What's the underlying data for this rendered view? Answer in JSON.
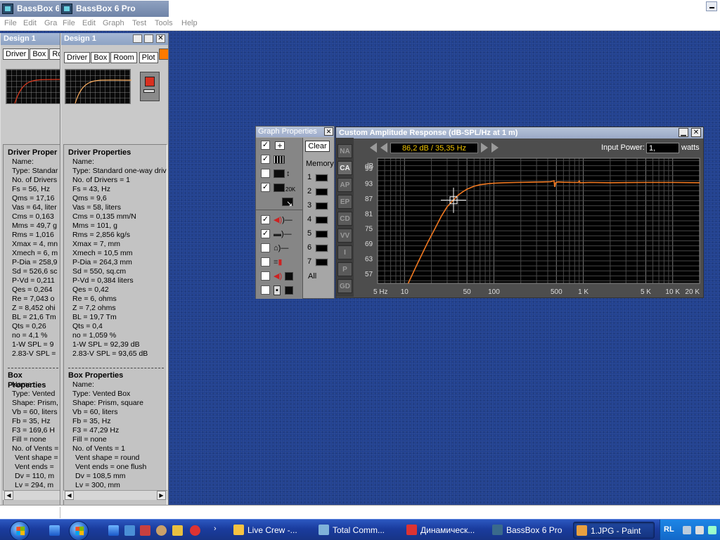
{
  "app_titles": [
    "BassBox 6",
    "BassBox 6 Pro"
  ],
  "menus": [
    [
      "File",
      "Edit",
      "Gra"
    ],
    [
      "File",
      "Edit",
      "Graph",
      "Test",
      "Tools",
      "Help"
    ]
  ],
  "design1": {
    "title": "Design 1",
    "tabs": [
      "Driver",
      "Box",
      "Ro"
    ],
    "driver_heading": "Driver Proper",
    "driver_lines": [
      "Name:",
      "Type: Standar",
      "No. of Drivers",
      "Fs = 56, Hz",
      "Qms = 17,16",
      "Vas = 64, liter",
      "Cms = 0,163",
      "Mms = 49,7 g",
      "Rms = 1,016",
      "Xmax = 4, mn",
      "Xmech = 6, m",
      "P-Dia = 258,9",
      "Sd = 526,6 sc",
      "P-Vd = 0,211",
      "Qes = 0,264",
      "Re = 7,043 o",
      "Z = 8,452 ohi",
      "BL = 21,6 Tm",
      "Qts = 0,26",
      "no = 4,1 %",
      "1-W SPL = 9",
      "2.83-V SPL ="
    ],
    "box_heading": "Box Properties",
    "box_lines": [
      "Name:",
      "Type: Vented",
      "Shape: Prism,",
      "Vb = 60, liters",
      "Fb = 35, Hz",
      "F3 = 169,6 H",
      "Fill = none",
      "No. of Vents ="
    ],
    "vent_lines": [
      "Vent shape =",
      "Vent ends ="
    ],
    "dim_lines": [
      "Dv = 110, m",
      "Lv = 294, m"
    ]
  },
  "design2": {
    "title": "Design 1",
    "tabs": [
      "Driver",
      "Box",
      "Room",
      "Plot"
    ],
    "driver_heading": "Driver Properties",
    "driver_lines": [
      "Name:",
      "Type: Standard one-way driv",
      "No. of Drivers = 1",
      "Fs = 43, Hz",
      "Qms = 9,6",
      "Vas = 58, liters",
      "Cms = 0,135 mm/N",
      "Mms = 101, g",
      "Rms = 2,856 kg/s",
      "Xmax = 7, mm",
      "Xmech = 10,5 mm",
      "P-Dia = 264,3 mm",
      "Sd = 550, sq.cm",
      "P-Vd = 0,384 liters",
      "Qes = 0,42",
      "Re = 6, ohms",
      "Z = 7,2 ohms",
      "BL = 19,7 Tm",
      "Qts = 0,4",
      "no = 1,059 %",
      "1-W SPL = 92,39 dB",
      "2.83-V SPL = 93,65 dB"
    ],
    "box_heading": "Box Properties",
    "box_lines": [
      "Name:",
      "Type: Vented Box",
      "Shape: Prism, square",
      "Vb = 60, liters",
      "Fb = 35, Hz",
      "F3 = 47,29 Hz",
      "Fill = none",
      "No. of Vents = 1"
    ],
    "vent_lines": [
      "Vent shape = round",
      "Vent ends = one flush"
    ],
    "dim_lines": [
      "Dv = 108,5 mm",
      "Lv = 300, mm"
    ]
  },
  "graph_props": {
    "title": "Graph Properties",
    "clear_label": "Clear",
    "memory_label": "Memory",
    "memory_slots": [
      "1",
      "2",
      "3",
      "4",
      "5",
      "6",
      "7"
    ],
    "all_label": "All",
    "option_icons": [
      "crosshair-icon",
      "grid-icon",
      "scale-vertical-icon",
      "extend-20k-icon",
      "graph-export-icon",
      "speaker-icon",
      "driver-icon",
      "room-icon",
      "amplifier-icon",
      "speaker-eq-icon",
      "box-eq-icon"
    ],
    "option_checked": [
      true,
      true,
      false,
      true,
      false,
      true,
      true,
      false,
      false,
      false,
      false
    ],
    "range_label": "20K"
  },
  "response": {
    "title": "Custom Amplitude Response (dB-SPL/Hz at 1 m)",
    "tabs": [
      "NA",
      "CA",
      "AP",
      "EP",
      "CD",
      "VV",
      "I",
      "P",
      "GD"
    ],
    "active_tab": "CA",
    "readout": "86,2 dB / 35,35 Hz",
    "input_power_label": "Input Power:",
    "input_power_value": "1,",
    "input_power_unit": "watts",
    "db_label": "dB",
    "curve_color": "#f07820"
  },
  "chart_data": {
    "type": "line",
    "xlabel": "",
    "ylabel": "dB",
    "x_scale": "log",
    "xlim": [
      5,
      20000
    ],
    "ylim": [
      53,
      103
    ],
    "x_ticks": [
      {
        "v": 5,
        "label": "5 Hz"
      },
      {
        "v": 10,
        "label": "10"
      },
      {
        "v": 50,
        "label": "50"
      },
      {
        "v": 100,
        "label": "100"
      },
      {
        "v": 500,
        "label": "500"
      },
      {
        "v": 1000,
        "label": "1 K"
      },
      {
        "v": 5000,
        "label": "5 K"
      },
      {
        "v": 10000,
        "label": "10 K"
      },
      {
        "v": 20000,
        "label": "20 K"
      }
    ],
    "y_ticks": [
      99,
      93,
      87,
      81,
      75,
      69,
      63,
      57
    ],
    "grid": true,
    "series": [
      {
        "x": [
          11,
          14,
          18,
          22,
          26,
          30,
          35,
          40,
          45,
          50,
          60,
          70,
          85,
          100,
          130,
          180,
          250,
          350,
          430,
          470,
          480,
          490,
          520,
          600,
          800,
          880,
          900,
          920,
          1200,
          2000,
          5000,
          10000,
          20000
        ],
        "y": [
          53,
          61,
          69,
          75,
          80,
          83.6,
          86.2,
          88.3,
          89.6,
          90.6,
          91.8,
          92.4,
          92.8,
          93.0,
          93.2,
          93.3,
          93.4,
          93.5,
          93.6,
          94.0,
          91.5,
          93.2,
          93.5,
          93.4,
          93.3,
          93.3,
          93.9,
          93.2,
          93.3,
          93.2,
          93.3,
          93.3,
          93.2
        ]
      }
    ],
    "cursor": {
      "x": 35.35,
      "y": 86.2
    }
  },
  "status_bar": "",
  "taskbar": {
    "items": [
      {
        "label": "Live Crew -...",
        "icon": "winamp-icon",
        "color": "#f6c342"
      },
      {
        "label": "Total Comm...",
        "icon": "total-commander-icon",
        "color": "#7fb2d9"
      },
      {
        "label": "Динамическ...",
        "icon": "opera-icon",
        "color": "#d33"
      },
      {
        "label": "BassBox 6 Pro",
        "icon": "bassbox-icon",
        "color": "#3a6a8c"
      },
      {
        "label": "1.JPG - Paint",
        "icon": "paint-icon",
        "color": "#e8a040"
      }
    ],
    "active_item": "1.JPG - Paint",
    "tray_lang": "RL"
  }
}
